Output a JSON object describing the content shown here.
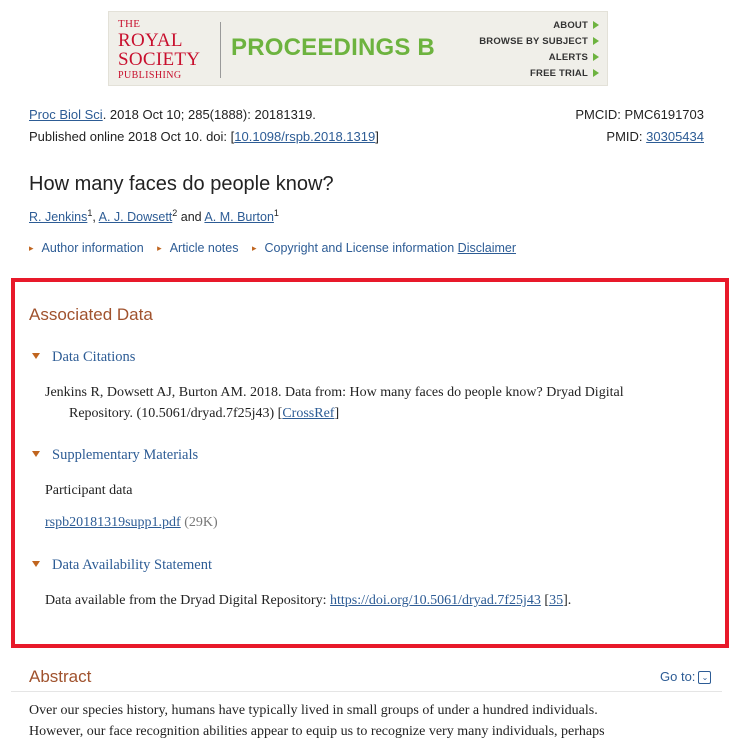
{
  "banner": {
    "logo_line1": "THE",
    "logo_line2": "ROYAL",
    "logo_line3": "SOCIETY",
    "logo_line4": "PUBLISHING",
    "journal": "PROCEEDINGS B",
    "nav": [
      "ABOUT",
      "BROWSE BY SUBJECT",
      "ALERTS",
      "FREE TRIAL"
    ],
    "accent_color": "#6db33f",
    "logo_color": "#c8102e"
  },
  "citation": {
    "journal_link": "Proc Biol Sci",
    "details": ". 2018 Oct 10; 285(1888): 20181319.",
    "published_prefix": "Published online 2018 Oct 10. doi:  [",
    "doi": "10.1098/rspb.2018.1319",
    "doi_suffix": "]",
    "pmcid": "PMCID: PMC6191703",
    "pmid_label": "PMID: ",
    "pmid": "30305434"
  },
  "article": {
    "title": "How many faces do people know?",
    "authors": [
      {
        "name": "R. Jenkins",
        "sup": "1",
        "sep": ", "
      },
      {
        "name": "A. J. Dowsett",
        "sup": "2",
        "sep": " and "
      },
      {
        "name": "A. M. Burton",
        "sup": "1",
        "sep": ""
      }
    ],
    "nav": {
      "author_info": "Author information",
      "article_notes": "Article notes",
      "copyright": "Copyright and License information",
      "disclaimer": "Disclaimer"
    }
  },
  "associated_data": {
    "heading": "Associated Data",
    "data_citations": {
      "heading": "Data Citations",
      "line1": "Jenkins R, Dowsett AJ, Burton AM. 2018. Data from: How many faces do people know? Dryad Digital",
      "line2": "Repository. (10.5061/dryad.7f25j43) [",
      "crossref": "CrossRef",
      "line2_end": "]"
    },
    "supplementary": {
      "heading": "Supplementary Materials",
      "participant": "Participant data",
      "file": "rspb20181319supp1.pdf",
      "size": " (29K)"
    },
    "availability": {
      "heading": "Data Availability Statement",
      "text": "Data available from the Dryad Digital Repository: ",
      "url": "https://doi.org/10.5061/dryad.7f25j43",
      "ref_open": " [",
      "ref": "35",
      "ref_close": "]."
    },
    "highlight_color": "#e8192a"
  },
  "abstract": {
    "heading": "Abstract",
    "goto": "Go to:",
    "goto_icon": "chevron-down-icon",
    "line1": "Over our species history, humans have typically lived in small groups of under a hundred individuals.",
    "line2": "However, our face recognition abilities appear to equip us to recognize very many individuals, perhaps"
  }
}
